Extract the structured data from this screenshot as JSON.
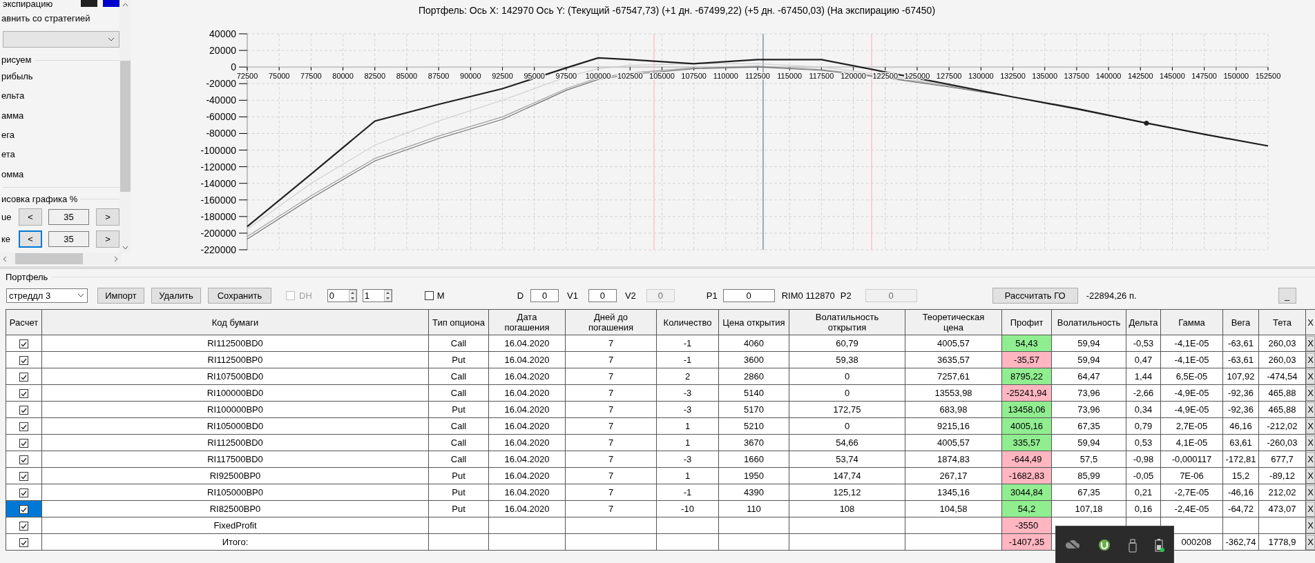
{
  "display_panel": {
    "swatch_label": "экспирацию",
    "swatches": [
      {
        "color": "#202020"
      },
      {
        "color": "#0000cc"
      }
    ],
    "compare_label": "авнить со стратегией",
    "draw_group": "рисуем",
    "draw_items": [
      "рибыль",
      "ельта",
      "амма",
      "ега",
      "ета",
      "омма"
    ],
    "range_group": "исовка графика %",
    "range_rows": [
      {
        "label": "ue",
        "prev": "<",
        "value": "35",
        "next": ">",
        "focused": false
      },
      {
        "label": "ке",
        "prev": "<",
        "value": "35",
        "next": ">",
        "focused": true
      }
    ]
  },
  "chart": {
    "chart_data": {
      "type": "line",
      "title": "Портфель: Ось X: 142970 Ось Y:  (Текущий -67547,73)  (+1 дн. -67499,22)  (+5 дн. -67450,03)  (На экспирацию -67450)",
      "xlim": [
        72500,
        152500
      ],
      "ylim": [
        -220000,
        40000
      ],
      "xticks": [
        72500,
        75000,
        77500,
        80000,
        82500,
        85000,
        87500,
        90000,
        92500,
        95000,
        97500,
        100000,
        102500,
        105000,
        107500,
        110000,
        112500,
        115000,
        117500,
        120000,
        122500,
        125000,
        127500,
        130000,
        132500,
        135000,
        137500,
        140000,
        142500,
        145000,
        147500,
        150000,
        152500
      ],
      "yticks": [
        40000,
        20000,
        0,
        -20000,
        -40000,
        -60000,
        -80000,
        -100000,
        -120000,
        -140000,
        -160000,
        -180000,
        -200000,
        -220000
      ],
      "x": [
        72500,
        77500,
        82500,
        87500,
        92500,
        97500,
        100000,
        102500,
        107500,
        112500,
        117500,
        122500,
        127500,
        132500,
        137500,
        142500,
        142970,
        147500,
        152500
      ],
      "series": [
        {
          "color": "#d0d0d0",
          "values": [
            -195000,
            -140000,
            -94000,
            -65000,
            -40000,
            -12000,
            -2000,
            2000,
            4000,
            4000,
            0,
            -10000,
            -22000,
            -36000,
            -51000,
            -66000,
            -67500,
            -81000,
            -95000
          ]
        },
        {
          "color": "#a0a0a0",
          "values": [
            -204000,
            -155000,
            -110000,
            -83000,
            -60000,
            -26000,
            -13000,
            -7000,
            -1000,
            1000,
            -3000,
            -12000,
            -23000,
            -36000,
            -51000,
            -66000,
            -67500,
            -81000,
            -95000
          ]
        },
        {
          "color": "#707070",
          "values": [
            -207000,
            -158000,
            -113000,
            -86000,
            -63000,
            -28000,
            -15000,
            -9000,
            -2000,
            0,
            -4000,
            -13000,
            -24000,
            -36000,
            -51000,
            -66000,
            -67500,
            -81000,
            -95000
          ]
        },
        {
          "color": "#202020",
          "values": [
            -192000,
            -129000,
            -65000,
            -45000,
            -26000,
            -1000,
            11000,
            9000,
            4000,
            9000,
            9000,
            -6000,
            -21000,
            -36000,
            -50000,
            -66000,
            -67500,
            -81000,
            -95000
          ]
        },
        {
          "color": "#202020",
          "marker": "circle",
          "values": [
            null,
            null,
            null,
            null,
            null,
            null,
            null,
            null,
            null,
            null,
            null,
            null,
            null,
            null,
            null,
            null,
            -67547.73,
            null,
            null
          ]
        }
      ],
      "grid": true,
      "stacked": false,
      "ref_lines": [
        {
          "axis": "x",
          "value": 104380,
          "color": "#ffc0cb"
        },
        {
          "axis": "x",
          "value": 112930,
          "color": "#8090a0"
        },
        {
          "axis": "x",
          "value": 121430,
          "color": "#ffc0cb"
        }
      ],
      "orientation": "vertical"
    }
  },
  "portfolio": {
    "title": "Портфель",
    "strategy": "стреддл 3",
    "buttons": [
      "Импорт",
      "Удалить",
      "Сохранить"
    ],
    "dh": {
      "label": "DH",
      "checked": false,
      "disabled": true
    },
    "spinners": [
      "0",
      "1"
    ],
    "m": {
      "label": "M",
      "checked": false
    },
    "fields": [
      {
        "label": "D",
        "value": "0",
        "disabled": false
      },
      {
        "label": "V1",
        "value": "0",
        "disabled": false
      },
      {
        "label": "V2",
        "value": "0",
        "disabled": true
      },
      {
        "label": "P1",
        "value": "0",
        "disabled": false
      }
    ],
    "instrument": "RIM0 112870",
    "p2": {
      "label": "P2",
      "value": "0",
      "disabled": true
    },
    "calc_button": "Рассчитать ГО",
    "margin": "-22894,26 п.",
    "minimize": "_"
  },
  "table": {
    "columns": [
      "Расчет",
      "Код бумаги",
      "Тип опциона",
      "Дата погашения",
      "Дней до погашения",
      "Количество",
      "Цена открытия",
      "Волатильность открытия",
      "Теоретическая цена",
      "Профит",
      "Волатильность",
      "Дельта",
      "Гамма",
      "Вега",
      "Тета",
      "X"
    ],
    "rows": [
      {
        "checked": true,
        "selected": false,
        "code": "RI112500BD0",
        "type": "Call",
        "date": "16.04.2020",
        "days": "7",
        "qty": "-1",
        "open_price": "4060",
        "open_vol": "60,79",
        "theor": "4005,57",
        "profit": "54,43",
        "color": "#90ee90",
        "vol": "59,94",
        "delta": "-0,53",
        "gamma": "-4,1E-05",
        "vega": "-63,61",
        "theta": "260,03",
        "remove": "X"
      },
      {
        "checked": true,
        "selected": false,
        "code": "RI112500BP0",
        "type": "Put",
        "date": "16.04.2020",
        "days": "7",
        "qty": "-1",
        "open_price": "3600",
        "open_vol": "59,38",
        "theor": "3635,57",
        "profit": "-35,57",
        "color": "#ffb6c1",
        "vol": "59,94",
        "delta": "0,47",
        "gamma": "-4,1E-05",
        "vega": "-63,61",
        "theta": "260,03",
        "remove": "X"
      },
      {
        "checked": true,
        "selected": false,
        "code": "RI107500BD0",
        "type": "Call",
        "date": "16.04.2020",
        "days": "7",
        "qty": "2",
        "open_price": "2860",
        "open_vol": "0",
        "theor": "7257,61",
        "profit": "8795,22",
        "color": "#90ee90",
        "vol": "64,47",
        "delta": "1,44",
        "gamma": "6,5E-05",
        "vega": "107,92",
        "theta": "-474,54",
        "remove": "X"
      },
      {
        "checked": true,
        "selected": false,
        "code": "RI100000BD0",
        "type": "Call",
        "date": "16.04.2020",
        "days": "7",
        "qty": "-3",
        "open_price": "5140",
        "open_vol": "0",
        "theor": "13553,98",
        "profit": "-25241,94",
        "color": "#ffb6c1",
        "vol": "73,96",
        "delta": "-2,66",
        "gamma": "-4,9E-05",
        "vega": "-92,36",
        "theta": "465,88",
        "remove": "X"
      },
      {
        "checked": true,
        "selected": false,
        "code": "RI100000BP0",
        "type": "Put",
        "date": "16.04.2020",
        "days": "7",
        "qty": "-3",
        "open_price": "5170",
        "open_vol": "172,75",
        "theor": "683,98",
        "profit": "13458,06",
        "color": "#90ee90",
        "vol": "73,96",
        "delta": "0,34",
        "gamma": "-4,9E-05",
        "vega": "-92,36",
        "theta": "465,88",
        "remove": "X"
      },
      {
        "checked": true,
        "selected": false,
        "code": "RI105000BD0",
        "type": "Call",
        "date": "16.04.2020",
        "days": "7",
        "qty": "1",
        "open_price": "5210",
        "open_vol": "0",
        "theor": "9215,16",
        "profit": "4005,16",
        "color": "#90ee90",
        "vol": "67,35",
        "delta": "0,79",
        "gamma": "2,7E-05",
        "vega": "46,16",
        "theta": "-212,02",
        "remove": "X"
      },
      {
        "checked": true,
        "selected": false,
        "code": "RI112500BD0",
        "type": "Call",
        "date": "16.04.2020",
        "days": "7",
        "qty": "1",
        "open_price": "3670",
        "open_vol": "54,66",
        "theor": "4005,57",
        "profit": "335,57",
        "color": "#90ee90",
        "vol": "59,94",
        "delta": "0,53",
        "gamma": "4,1E-05",
        "vega": "63,61",
        "theta": "-260,03",
        "remove": "X"
      },
      {
        "checked": true,
        "selected": false,
        "code": "RI117500BD0",
        "type": "Call",
        "date": "16.04.2020",
        "days": "7",
        "qty": "-3",
        "open_price": "1660",
        "open_vol": "53,74",
        "theor": "1874,83",
        "profit": "-644,49",
        "color": "#ffb6c1",
        "vol": "57,5",
        "delta": "-0,98",
        "gamma": "-0,000117",
        "vega": "-172,81",
        "theta": "677,7",
        "remove": "X"
      },
      {
        "checked": true,
        "selected": false,
        "code": "RI92500BP0",
        "type": "Put",
        "date": "16.04.2020",
        "days": "7",
        "qty": "1",
        "open_price": "1950",
        "open_vol": "147,74",
        "theor": "267,17",
        "profit": "-1682,83",
        "color": "#ffb6c1",
        "vol": "85,99",
        "delta": "-0,05",
        "gamma": "7E-06",
        "vega": "15,2",
        "theta": "-89,12",
        "remove": "X"
      },
      {
        "checked": true,
        "selected": false,
        "code": "RI105000BP0",
        "type": "Put",
        "date": "16.04.2020",
        "days": "7",
        "qty": "-1",
        "open_price": "4390",
        "open_vol": "125,12",
        "theor": "1345,16",
        "profit": "3044,84",
        "color": "#90ee90",
        "vol": "67,35",
        "delta": "0,21",
        "gamma": "-2,7E-05",
        "vega": "-46,16",
        "theta": "212,02",
        "remove": "X"
      },
      {
        "checked": true,
        "selected": true,
        "code": "RI82500BP0",
        "type": "Put",
        "date": "16.04.2020",
        "days": "7",
        "qty": "-10",
        "open_price": "110",
        "open_vol": "108",
        "theor": "104,58",
        "profit": "54,2",
        "color": "#90ee90",
        "vol": "107,18",
        "delta": "0,16",
        "gamma": "-2,4E-05",
        "vega": "-64,72",
        "theta": "473,07",
        "remove": "X"
      },
      {
        "checked": true,
        "selected": false,
        "code": "FixedProfit",
        "profit": "-3550",
        "color": "#ffb6c1",
        "remove": "X"
      },
      {
        "checked": true,
        "selected": false,
        "code": "Итого:",
        "profit": "-1407,35",
        "color": "#ffb6c1",
        "gamma": "000208",
        "vega": "-362,74",
        "theta": "1778,9",
        "remove": "X"
      }
    ]
  }
}
